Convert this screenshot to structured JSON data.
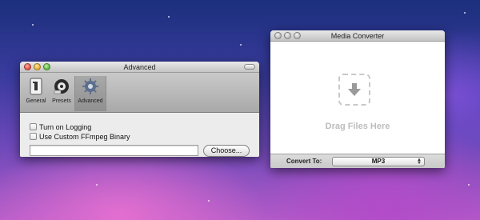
{
  "advanced_window": {
    "title": "Advanced",
    "toolbar": [
      {
        "label": "General",
        "icon": "general-icon"
      },
      {
        "label": "Presets",
        "icon": "presets-icon"
      },
      {
        "label": "Advanced",
        "icon": "gear-icon"
      }
    ],
    "options": [
      {
        "label": "Turn on Logging",
        "checked": false
      },
      {
        "label": "Use Custom FFmpeg Binary",
        "checked": false
      }
    ],
    "binary_path_value": "",
    "choose_label": "Choose..."
  },
  "media_converter": {
    "title": "Media Converter",
    "drop_label": "Drag Files Here",
    "drop_icon": "down-arrow-icon",
    "convert_to_label": "Convert To:",
    "selected_format": "MP3"
  }
}
